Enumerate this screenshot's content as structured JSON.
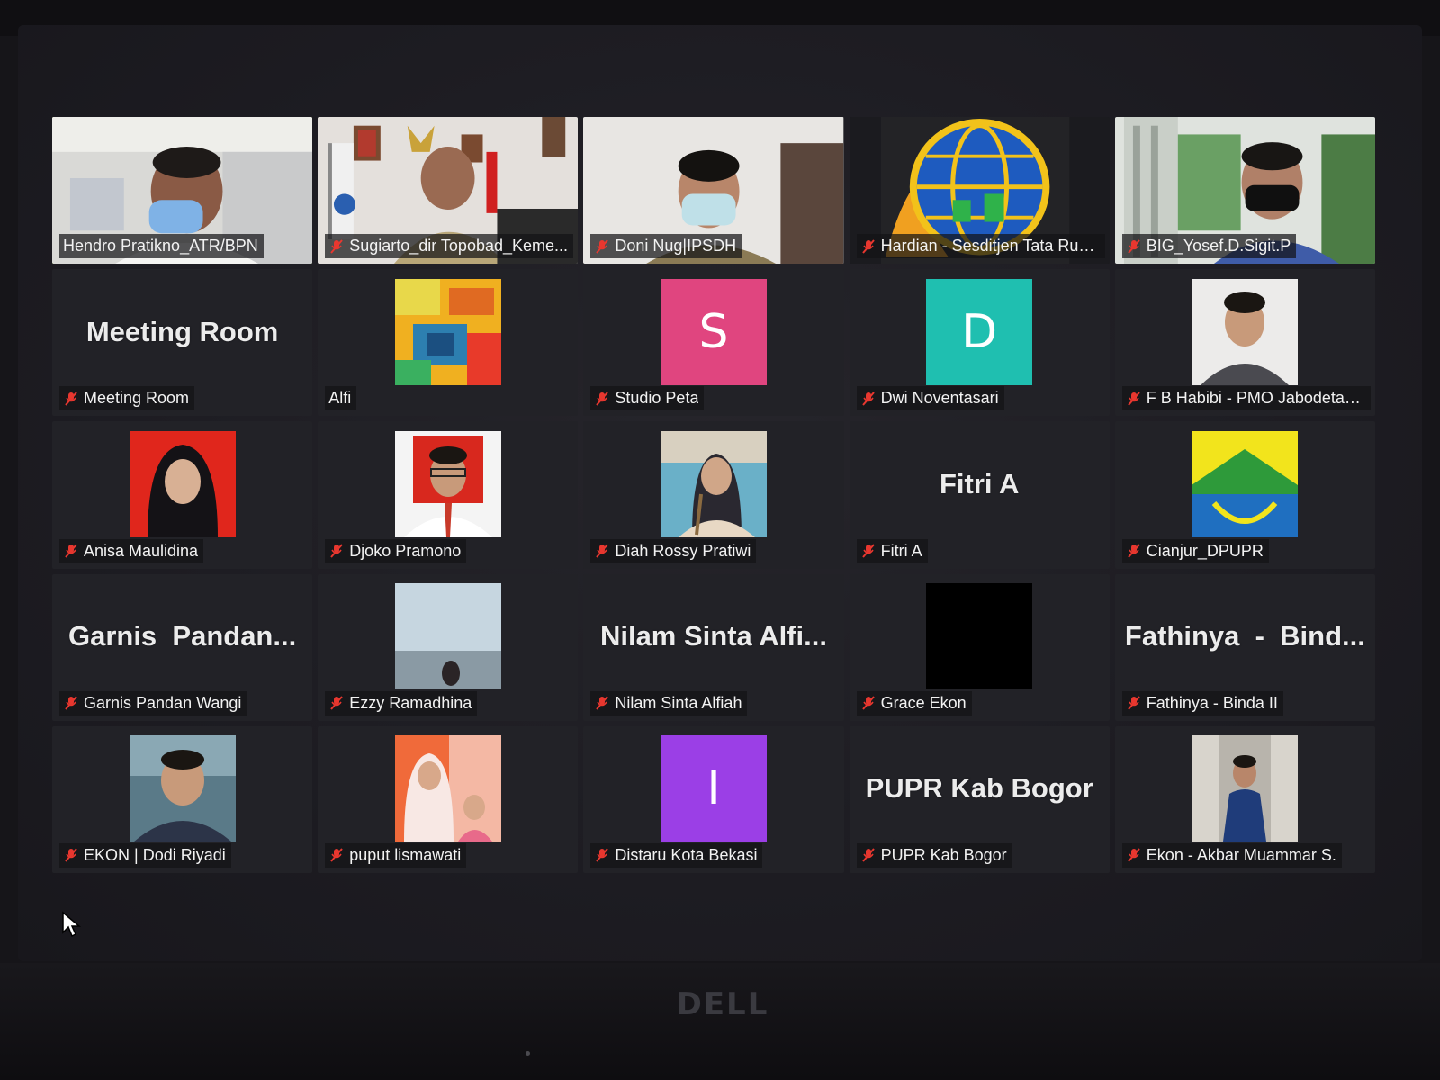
{
  "tiles": [
    {
      "label": "Hendro Pratikno_ATR/BPN",
      "muted": false,
      "active": true
    },
    {
      "label": "Sugiarto_dir Topobad_Keme...",
      "muted": true
    },
    {
      "label": "Doni Nug|IPSDH",
      "muted": true
    },
    {
      "label": "Hardian - Sesditjen Tata Rua...",
      "muted": true
    },
    {
      "label": "BIG_Yosef.D.Sigit.P",
      "muted": true
    },
    {
      "label": "Meeting Room",
      "muted": true,
      "name_display": "Meeting Room"
    },
    {
      "label": "Alfi",
      "muted": false
    },
    {
      "label": "Studio Peta",
      "muted": true,
      "avatar_letter": "S",
      "avatar_color": "#e0457f"
    },
    {
      "label": "Dwi Noventasari",
      "muted": true,
      "avatar_letter": "D",
      "avatar_color": "#1fbfb0"
    },
    {
      "label": "F B Habibi - PMO Jabodetab...",
      "muted": true
    },
    {
      "label": "Anisa Maulidina",
      "muted": true
    },
    {
      "label": "Djoko Pramono",
      "muted": true
    },
    {
      "label": "Diah Rossy Pratiwi",
      "muted": true
    },
    {
      "label": "Fitri A",
      "muted": true,
      "name_display": "Fitri A"
    },
    {
      "label": "Cianjur_DPUPR",
      "muted": true
    },
    {
      "label": "Garnis Pandan Wangi",
      "muted": true,
      "name_display": "Garnis  Pandan..."
    },
    {
      "label": "Ezzy Ramadhina",
      "muted": true
    },
    {
      "label": "Nilam Sinta Alfiah",
      "muted": true,
      "name_display": "Nilam Sinta Alfi..."
    },
    {
      "label": "Grace Ekon",
      "muted": true
    },
    {
      "label": "Fathinya - Binda II",
      "muted": true,
      "name_display": "Fathinya  -  Bind..."
    },
    {
      "label": "EKON | Dodi Riyadi",
      "muted": true
    },
    {
      "label": "puput lismawati",
      "muted": true
    },
    {
      "label": "Distaru Kota Bekasi",
      "muted": true,
      "avatar_letter": "I",
      "avatar_color": "#9b3fe6"
    },
    {
      "label": "PUPR Kab Bogor",
      "muted": true,
      "name_display": "PUPR Kab Bogor"
    },
    {
      "label": "Ekon - Akbar Muammar S.",
      "muted": true
    }
  ],
  "colors": {
    "active_border": "#b7e84b",
    "muted_icon": "#e8372f"
  },
  "bezel": {
    "brand": "DELL"
  }
}
